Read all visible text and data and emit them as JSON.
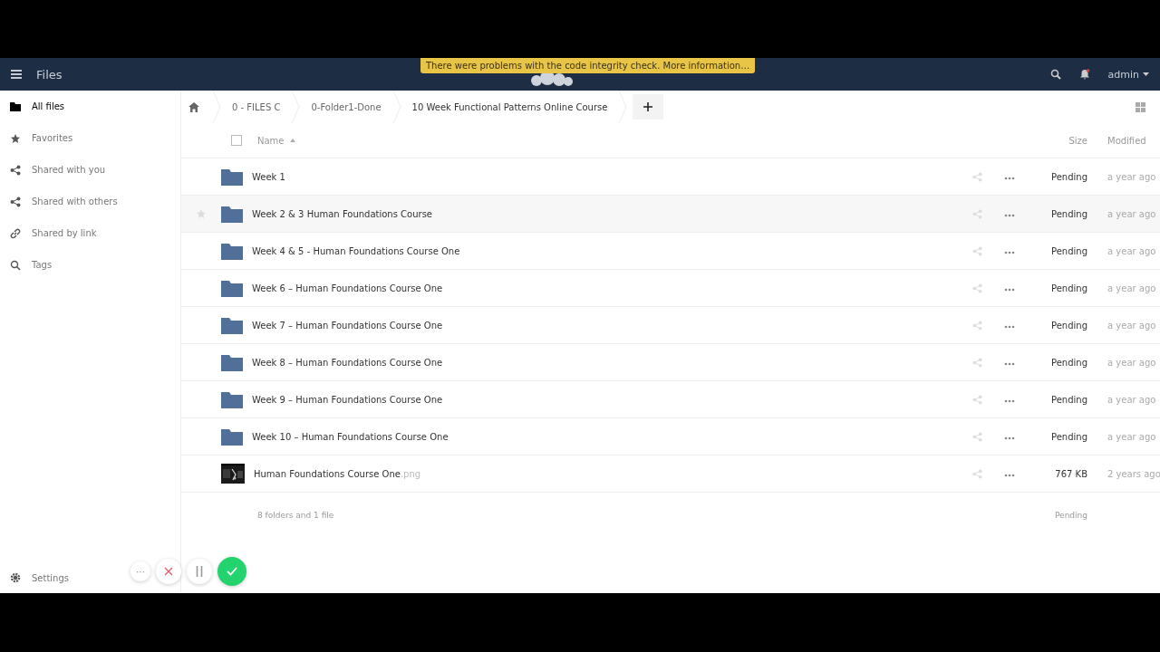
{
  "header": {
    "app_title": "Files",
    "notice": "There were problems with the code integrity check. More information…",
    "user": "admin",
    "notification_unread": true
  },
  "sidebar": {
    "items": [
      {
        "label": "All files",
        "selected": true
      },
      {
        "label": "Favorites",
        "selected": false
      },
      {
        "label": "Shared with you",
        "selected": false
      },
      {
        "label": "Shared with others",
        "selected": false
      },
      {
        "label": "Shared by link",
        "selected": false
      },
      {
        "label": "Tags",
        "selected": false
      }
    ],
    "settings": "Settings"
  },
  "breadcrumbs": [
    "0 - FILES C",
    "0-Folder1-Done",
    "10 Week Functional Patterns Online Course"
  ],
  "table": {
    "select_all_checked": false,
    "columns": {
      "name": "Name",
      "size": "Size",
      "modified": "Modified"
    },
    "rows": [
      {
        "kind": "folder",
        "name": "Week 1",
        "size": "Pending",
        "modified": "a year ago",
        "hovered": false
      },
      {
        "kind": "folder",
        "name": "Week 2 & 3 Human Foundations Course",
        "size": "Pending",
        "modified": "a year ago",
        "hovered": true
      },
      {
        "kind": "folder",
        "name": "Week 4 & 5 - Human Foundations Course One",
        "size": "Pending",
        "modified": "a year ago",
        "hovered": false
      },
      {
        "kind": "folder",
        "name": "Week 6 – Human Foundations Course One",
        "size": "Pending",
        "modified": "a year ago",
        "hovered": false
      },
      {
        "kind": "folder",
        "name": "Week 7 – Human Foundations Course One",
        "size": "Pending",
        "modified": "a year ago",
        "hovered": false
      },
      {
        "kind": "folder",
        "name": "Week 8 – Human Foundations Course One",
        "size": "Pending",
        "modified": "a year ago",
        "hovered": false
      },
      {
        "kind": "folder",
        "name": "Week 9 – Human Foundations Course One",
        "size": "Pending",
        "modified": "a year ago",
        "hovered": false
      },
      {
        "kind": "folder",
        "name": "Week 10 – Human Foundations Course One",
        "size": "Pending",
        "modified": "a year ago",
        "hovered": false
      },
      {
        "kind": "file",
        "name": "Human Foundations Course One",
        "ext": ".png",
        "size": "767 KB",
        "modified": "2 years ago",
        "hovered": false
      }
    ],
    "summary": {
      "count": "8 folders and 1 file",
      "size": "Pending"
    }
  },
  "recorder": {
    "more": "···"
  }
}
